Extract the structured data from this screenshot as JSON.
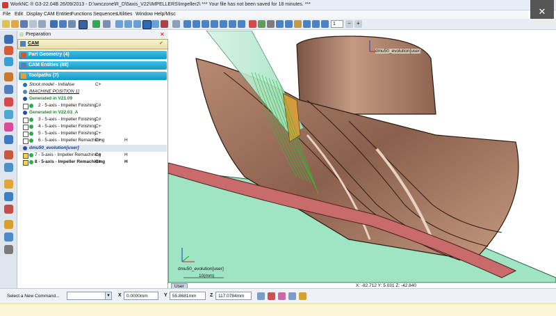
{
  "title": "WorkNC ® G3-22.04B   26/09/2013 - D:\\wnczone\\R_D\\5axis_V22\\IMPELLERS\\Impeller2\\ *** Your file has not been saved for 18 minutes. ***",
  "menu": [
    "File",
    "Edit",
    "Display",
    "CAM Entities",
    "Functions",
    "Sequences",
    "Utilities",
    "Window",
    "Help/Misc"
  ],
  "toolbar": {
    "level_value": "1"
  },
  "tree": {
    "header": "Preparation",
    "cam_label": "CAM",
    "groups": {
      "part_geometry": "Part Geometry (4)",
      "cam_entities": "CAM Entities (88)",
      "toolpaths": "Toolpaths (7)"
    },
    "rows": [
      {
        "label": "Stock model - Initialise",
        "c1": "C+",
        "c2": ""
      },
      {
        "label": "[MACHINE POSITION 1]",
        "c1": "",
        "c2": ""
      },
      {
        "label": "Generated in V21.09",
        "c1": "",
        "c2": ""
      },
      {
        "label": "2 - 5-axis - Impeller Finishing",
        "c1": "C#",
        "c2": ""
      },
      {
        "label": "Generated in V22.03_A",
        "c1": "",
        "c2": ""
      },
      {
        "label": "3 - 5-axis - Impeller Finishing",
        "c1": "C#",
        "c2": ""
      },
      {
        "label": "4 - 5-axis - Impeller Finishing",
        "c1": "C+",
        "c2": ""
      },
      {
        "label": "5 - 5-axis - Impeller Finishing",
        "c1": "C+",
        "c2": ""
      },
      {
        "label": "6 - 5-axis - Impeller Remachining",
        "c1": "C+",
        "c2": "H"
      },
      {
        "label": "dmu50_evolution[user]",
        "c1": "",
        "c2": ""
      },
      {
        "label": "7 - 5-axis - Impeller Remachining",
        "c1": "C+",
        "c2": "H"
      },
      {
        "label": "8 - 5-axis - Impeller Remachining",
        "c1": "C+",
        "c2": "H"
      }
    ]
  },
  "viewport": {
    "top_label": "dmu50_evolution[user]",
    "bottom_label": "dmu50_evolution[user]",
    "scale_label": "10(mm)",
    "coords": "X: -82.712   Y: 5.031   Z: -42.840",
    "tab_label": "User"
  },
  "status": {
    "command_prompt": "Select a New Command...",
    "x_label": "X",
    "x_value": "0.0000mm",
    "y_label": "Y",
    "y_value": "55.8681mm",
    "z_label": "Z",
    "z_value": "117.0784mm"
  },
  "colors": {
    "part": "#a3735b",
    "floor": "#c96b6b",
    "toolpath": "#22c832",
    "tool": "#d59a3d",
    "group_header": "#1e9fd2",
    "stock": "#7ad9b4"
  }
}
